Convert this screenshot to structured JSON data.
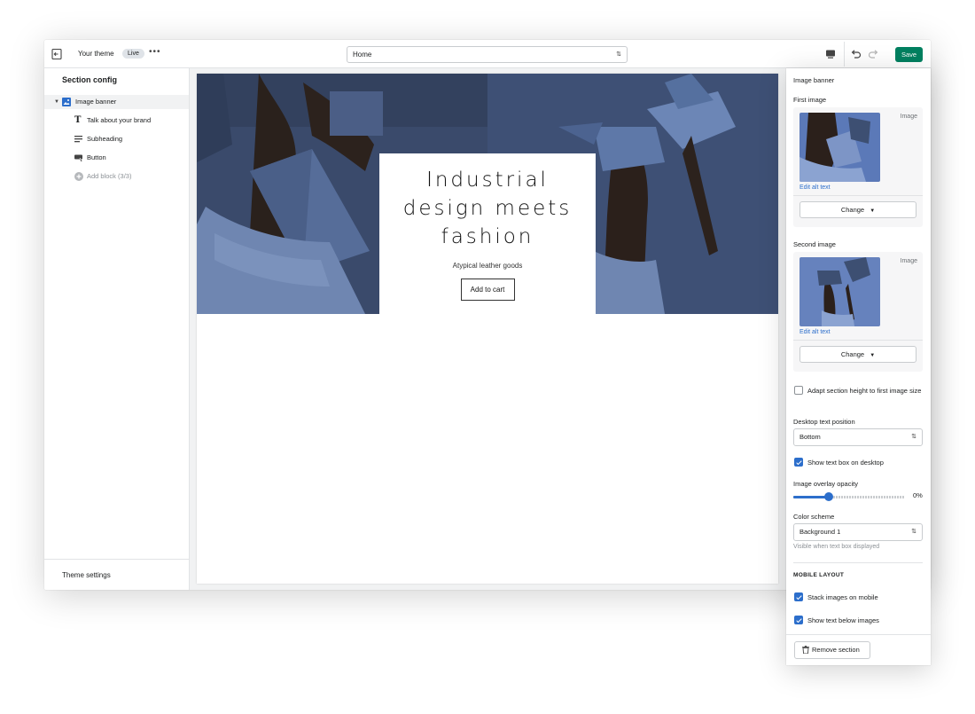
{
  "topbar": {
    "theme_name": "Your theme",
    "status_badge": "Live",
    "more": "•••",
    "page_select": "Home",
    "save_label": "Save"
  },
  "sidebar": {
    "title": "Section config",
    "items": [
      {
        "label": "Image banner",
        "icon": "image-icon"
      },
      {
        "label": "Talk about your brand",
        "icon": "text-icon"
      },
      {
        "label": "Subheading",
        "icon": "align-left-icon"
      },
      {
        "label": "Button",
        "icon": "button-icon"
      },
      {
        "label": "Add block (3/3)",
        "icon": "add-circle-icon"
      }
    ],
    "theme_settings": "Theme settings"
  },
  "preview": {
    "heading": "Industrial design meets fashion",
    "subheading": "Atypical leather goods",
    "button_label": "Add to cart"
  },
  "settings": {
    "title": "Image banner",
    "first_image": {
      "label": "First image",
      "tag": "Image",
      "alt_link": "Edit alt text",
      "change": "Change"
    },
    "second_image": {
      "label": "Second image",
      "tag": "Image",
      "alt_link": "Edit alt text",
      "change": "Change"
    },
    "adapt_height": {
      "label": "Adapt section height to first image size",
      "checked": false
    },
    "text_position": {
      "label": "Desktop text position",
      "value": "Bottom"
    },
    "show_text_box": {
      "label": "Show text box on desktop",
      "checked": true
    },
    "overlay_opacity": {
      "label": "Image overlay opacity",
      "value": "0%",
      "level": 0.32
    },
    "color_scheme": {
      "label": "Color scheme",
      "value": "Background 1",
      "hint": "Visible when text box displayed"
    },
    "mobile_layout": {
      "caption": "MOBILE LAYOUT",
      "stack_images": {
        "label": "Stack images on mobile",
        "checked": true
      },
      "text_below": {
        "label": "Show text below images",
        "checked": true
      }
    },
    "remove_label": "Remove section"
  },
  "colors": {
    "accent": "#2c6ecb",
    "save": "#008060",
    "banner_blue": "#3d4f72"
  }
}
